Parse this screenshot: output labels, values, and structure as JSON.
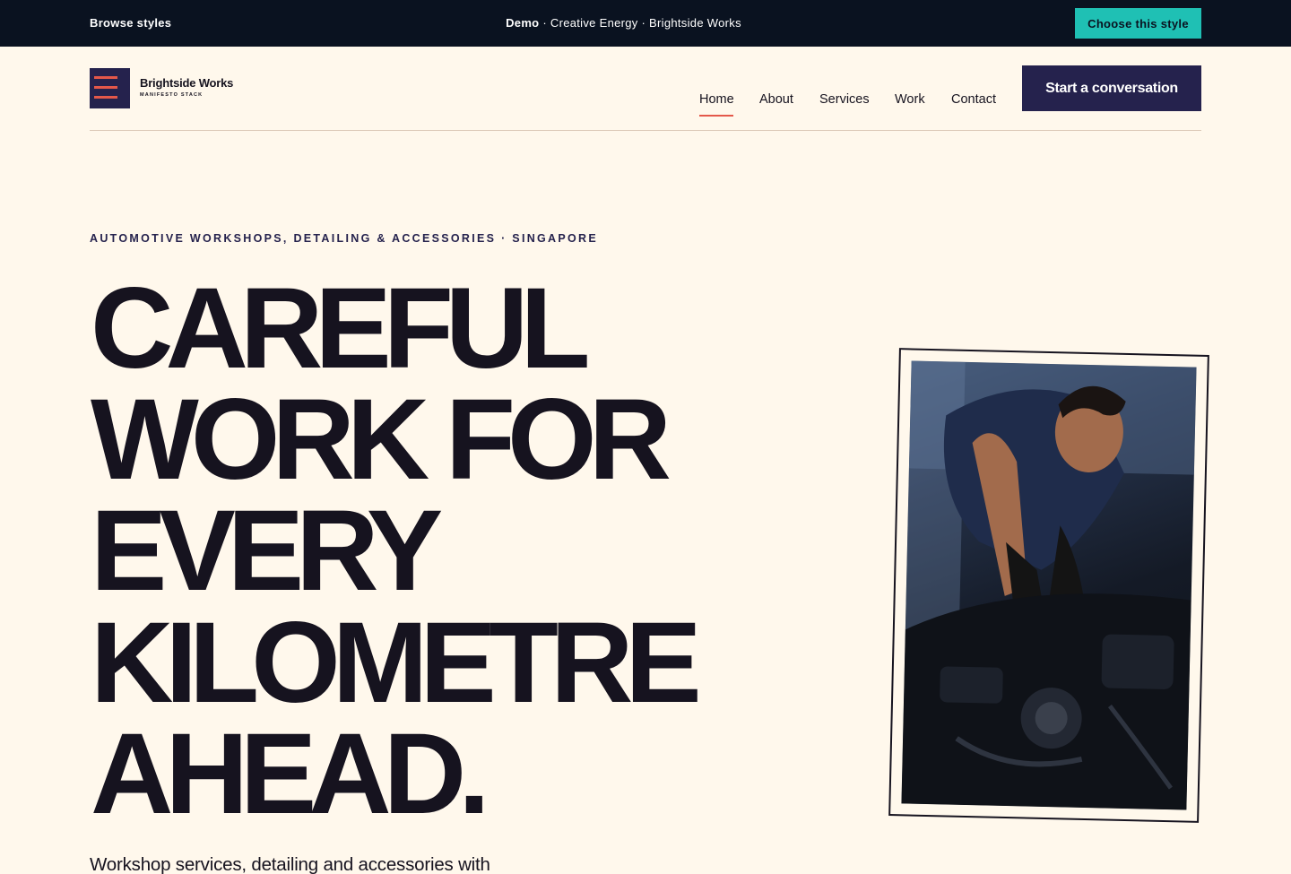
{
  "demo_bar": {
    "browse_label": "Browse styles",
    "demo_label": "Demo",
    "demo_detail": " · Creative Energy · Brightside Works",
    "choose_label": "Choose this style"
  },
  "header": {
    "brand_name": "Brightside Works",
    "brand_sub": "MANIFESTO STACK",
    "nav": [
      {
        "label": "Home",
        "active": true
      },
      {
        "label": "About"
      },
      {
        "label": "Services"
      },
      {
        "label": "Work"
      },
      {
        "label": "Contact"
      }
    ],
    "cta_label": "Start a conversation"
  },
  "hero": {
    "eyebrow": "AUTOMOTIVE WORKSHOPS, DETAILING & ACCESSORIES · SINGAPORE",
    "headline": [
      "CAREFUL",
      "WORK FOR",
      "EVERY",
      "KILOMETRE",
      "AHEAD."
    ],
    "subline": "Workshop services, detailing and accessories with"
  },
  "colors": {
    "page_bg": "#fff8ec",
    "demo_bar_bg": "#0a1220",
    "choose_button": "#1fc0b4",
    "brand_navy": "#25224d",
    "accent_coral": "#e4584a",
    "ink": "#16131f"
  },
  "icons": {
    "logo": "hamburger-menu-icon"
  }
}
